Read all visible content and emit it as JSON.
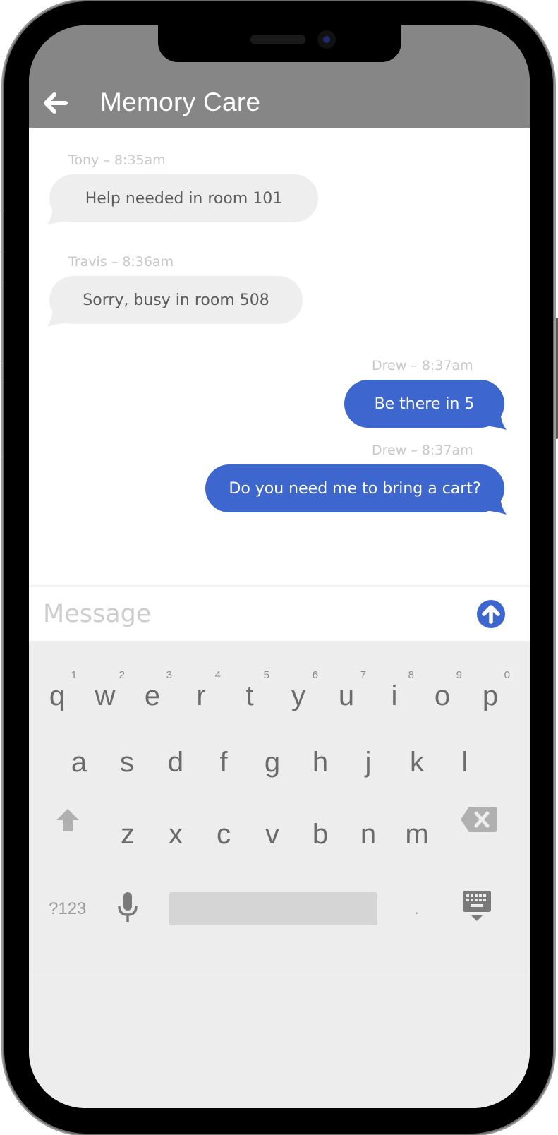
{
  "header": {
    "back_icon": "arrow-left-icon",
    "title": "Memory Care"
  },
  "messages": [
    {
      "sender": "Tony",
      "time": "8:35am",
      "meta": "Tony – 8:35am",
      "text": "Help needed in room 101",
      "direction": "incoming"
    },
    {
      "sender": "Travis",
      "time": "8:36am",
      "meta": "Travis – 8:36am",
      "text": "Sorry, busy in room 508",
      "direction": "incoming"
    },
    {
      "sender": "Drew",
      "time": "8:37am",
      "meta": "Drew – 8:37am",
      "text": "Be there in 5",
      "direction": "outgoing"
    },
    {
      "sender": "Drew",
      "time": "8:37am",
      "meta": "Drew – 8:37am",
      "text": "Do you need me to bring a cart?",
      "direction": "outgoing"
    }
  ],
  "composer": {
    "placeholder": "Message",
    "value": "",
    "send_icon": "arrow-up-circle-icon"
  },
  "keyboard": {
    "row1": [
      {
        "key": "q",
        "hint": "1"
      },
      {
        "key": "w",
        "hint": "2"
      },
      {
        "key": "e",
        "hint": "3"
      },
      {
        "key": "r",
        "hint": "4"
      },
      {
        "key": "t",
        "hint": "5"
      },
      {
        "key": "y",
        "hint": "6"
      },
      {
        "key": "u",
        "hint": "7"
      },
      {
        "key": "i",
        "hint": "8"
      },
      {
        "key": "o",
        "hint": "9"
      },
      {
        "key": "p",
        "hint": "0"
      }
    ],
    "row2": [
      "a",
      "s",
      "d",
      "f",
      "g",
      "h",
      "j",
      "k",
      "l"
    ],
    "row3": [
      "z",
      "x",
      "c",
      "v",
      "b",
      "n",
      "m"
    ],
    "symbols_label": "?123",
    "period_label": ".",
    "shift_icon": "shift-arrow-icon",
    "backspace_icon": "backspace-icon",
    "mic_icon": "microphone-icon",
    "hide_keyboard_icon": "keyboard-hide-icon"
  },
  "colors": {
    "header_bg": "#868686",
    "outgoing_bubble": "#3d66cf",
    "incoming_bubble": "#eeeeee",
    "keyboard_bg": "#ededed"
  }
}
